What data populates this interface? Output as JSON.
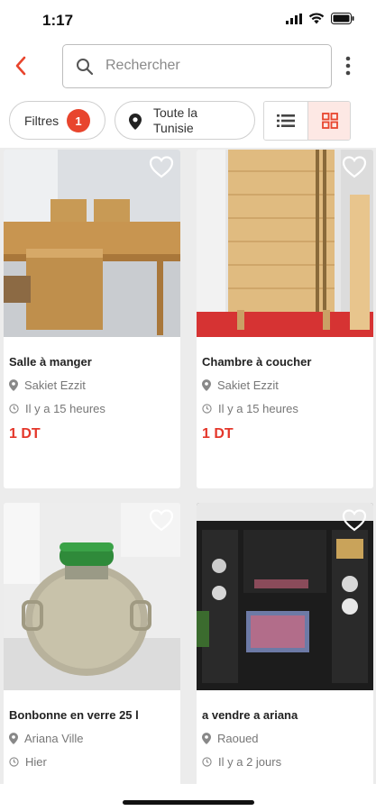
{
  "status_bar": {
    "time": "1:17"
  },
  "header": {
    "search_placeholder": "Rechercher"
  },
  "filters": {
    "label": "Filtres",
    "count": "1",
    "location": "Toute la Tunisie"
  },
  "listings": [
    {
      "title": "Salle à manger",
      "location": "Sakiet Ezzit",
      "time": "Il y a 15 heures",
      "price": "1 DT"
    },
    {
      "title": "Chambre à coucher",
      "location": "Sakiet Ezzit",
      "time": "Il y a 15 heures",
      "price": "1 DT"
    },
    {
      "title": "Bonbonne en verre 25 l",
      "location": "Ariana Ville",
      "time": "Hier",
      "price": ""
    },
    {
      "title": "a vendre a ariana",
      "location": "Raoued",
      "time": "Il y a 2 jours",
      "price": ""
    }
  ],
  "colors": {
    "accent": "#e8452d",
    "price": "#e4372b",
    "grid_toggle_bg": "#fde8e4"
  },
  "icons": [
    "back-arrow-icon",
    "search-icon",
    "more-vertical-icon",
    "location-pin-icon",
    "list-view-icon",
    "grid-view-icon",
    "heart-outline-icon",
    "clock-icon",
    "wifi-icon",
    "battery-icon",
    "signal-icon"
  ]
}
